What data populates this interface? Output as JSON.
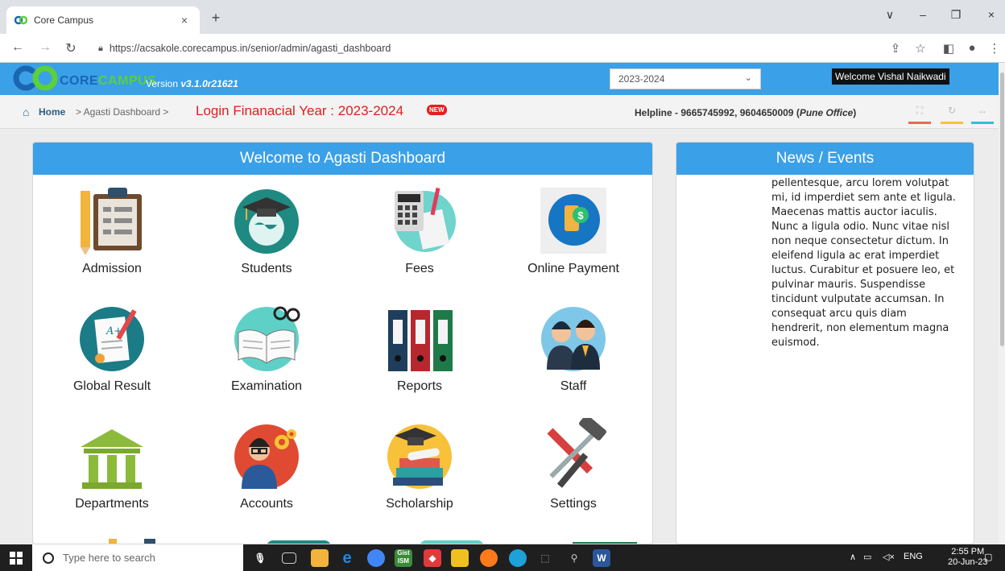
{
  "browser": {
    "tab_title": "Core Campus",
    "tab_close": "×",
    "new_tab": "+",
    "url": "https://acsakole.corecampus.in/senior/admin/agasti_dashboard",
    "window_controls": [
      "∨",
      "–",
      "❐",
      "×"
    ]
  },
  "header": {
    "brand_core": "CORE",
    "brand_campus": "CAMPUS",
    "version_label": "Version",
    "version_value": "v3.1.0r21621",
    "year_selected": "2023-2024",
    "welcome": "Welcome Vishal Naikwadi"
  },
  "breadcrumb": {
    "home": "Home",
    "rest": "> Agasti Dashboard >",
    "login_fy": "Login Finanacial Year : 2023-2024",
    "new_badge": "NEW",
    "helpline": "Helpline - 9665745992, 9604650009 (",
    "helpline_office": "Pune Office",
    "helpline_end": ")"
  },
  "dashboard": {
    "title": "Welcome to Agasti Dashboard",
    "tiles": [
      {
        "label": "Admission",
        "icon": "clipboard-icon"
      },
      {
        "label": "Students",
        "icon": "graduation-globe-icon"
      },
      {
        "label": "Fees",
        "icon": "calculator-icon"
      },
      {
        "label": "Online Payment",
        "icon": "mobile-payment-icon"
      },
      {
        "label": "Global Result",
        "icon": "certificate-icon"
      },
      {
        "label": "Examination",
        "icon": "book-glasses-icon"
      },
      {
        "label": "Reports",
        "icon": "binders-icon"
      },
      {
        "label": "Staff",
        "icon": "staff-group-icon"
      },
      {
        "label": "Departments",
        "icon": "building-icon"
      },
      {
        "label": "Accounts",
        "icon": "accountant-icon"
      },
      {
        "label": "Scholarship",
        "icon": "scholarship-icon"
      },
      {
        "label": "Settings",
        "icon": "tools-icon"
      }
    ]
  },
  "news": {
    "title": "News / Events",
    "body": "pellentesque, arcu lorem volutpat mi, id imperdiet sem ante et ligula. Maecenas mattis auctor iaculis. Nunc a ligula odio. Nunc vitae nisl non neque consectetur dictum. In eleifend ligula ac erat imperdiet luctus. Curabitur et posuere leo, et pulvinar mauris. Suspendisse tincidunt vulputate accumsan. In consequat arcu quis diam hendrerit, non elementum magna euismod."
  },
  "taskbar": {
    "search_placeholder": "Type here to search",
    "lang": "ENG",
    "time": "2:55 PM",
    "date": "20-Jun-23"
  },
  "colors": {
    "accent": "#3aa0e8",
    "alert_red": "#e02020"
  }
}
